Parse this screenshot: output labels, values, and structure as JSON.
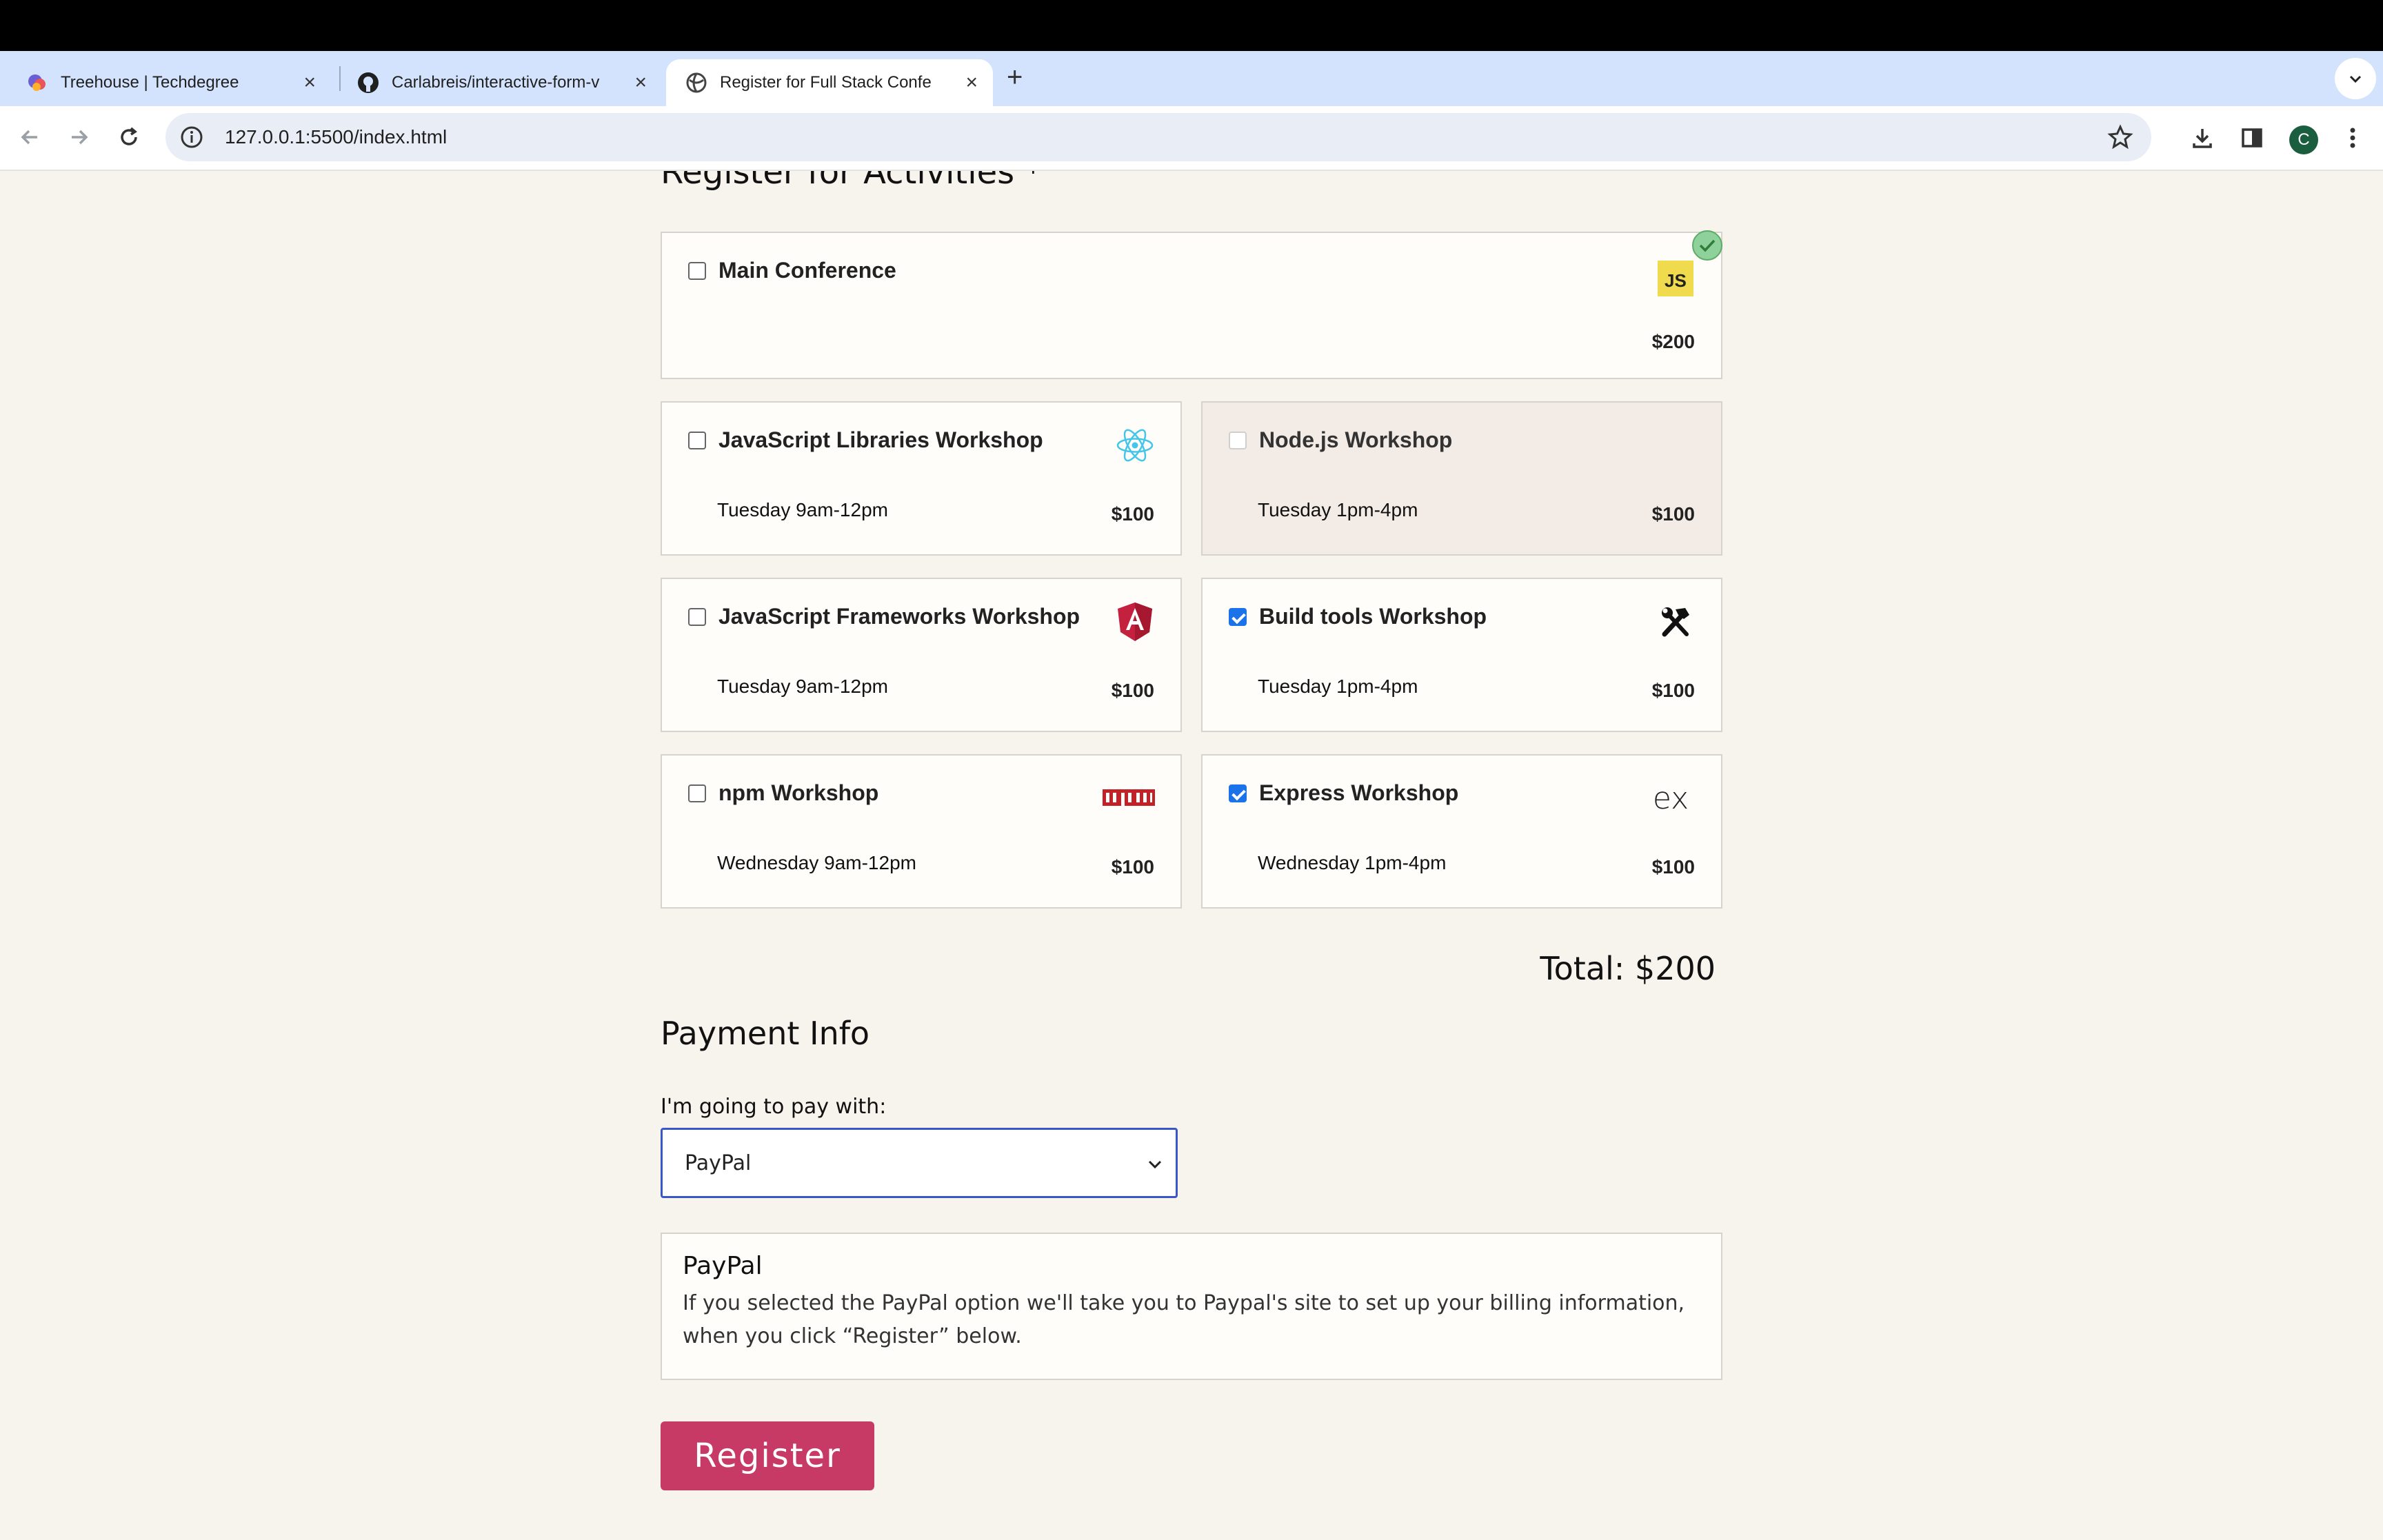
{
  "browser": {
    "tabs": [
      {
        "title": "Treehouse | Techdegree",
        "favicon": "treehouse-icon"
      },
      {
        "title": "Carlabreis/interactive-form-v",
        "favicon": "github-icon"
      },
      {
        "title": "Register for Full Stack Confe",
        "favicon": "globe-icon"
      }
    ],
    "url": "127.0.0.1:5500/index.html",
    "profile_initial": "C",
    "new_tab_glyph": "+"
  },
  "activities": {
    "heading": "Register for Activities *",
    "main": {
      "name": "Main Conference",
      "cost": "$200",
      "checked": false,
      "logo": "javascript-logo-icon",
      "logo_text": "JS"
    },
    "workshops": [
      {
        "name": "JavaScript Libraries Workshop",
        "time": "Tuesday 9am-12pm",
        "cost": "$100",
        "checked": false,
        "disabled": false,
        "logo": "react-logo-icon"
      },
      {
        "name": "Node.js Workshop",
        "time": "Tuesday 1pm-4pm",
        "cost": "$100",
        "checked": false,
        "disabled": true,
        "logo": "none"
      },
      {
        "name": "JavaScript Frameworks Workshop",
        "time": "Tuesday 9am-12pm",
        "cost": "$100",
        "checked": false,
        "disabled": false,
        "logo": "angular-logo-icon"
      },
      {
        "name": "Build tools Workshop",
        "time": "Tuesday 1pm-4pm",
        "cost": "$100",
        "checked": true,
        "disabled": false,
        "logo": "hammer-wrench-icon"
      },
      {
        "name": "npm Workshop",
        "time": "Wednesday 9am-12pm",
        "cost": "$100",
        "checked": false,
        "disabled": false,
        "logo": "npm-logo-icon"
      },
      {
        "name": "Express Workshop",
        "time": "Wednesday 1pm-4pm",
        "cost": "$100",
        "checked": true,
        "disabled": false,
        "logo": "express-logo-icon",
        "logo_text": "ex"
      }
    ],
    "total": "Total: $200"
  },
  "payment": {
    "heading": "Payment Info",
    "label": "I'm going to pay with:",
    "selected": "PayPal",
    "paypal_title": "PayPal",
    "paypal_text": "If you selected the PayPal option we'll take you to Paypal's site to set up your billing information, when you click “Register” below."
  },
  "register_label": "Register",
  "colors": {
    "accent": "#c73a66",
    "checkbox": "#1a73e8",
    "select_border": "#3a57c9",
    "page_bg": "#f7f3ed",
    "tabstrip": "#d3e3fd"
  }
}
